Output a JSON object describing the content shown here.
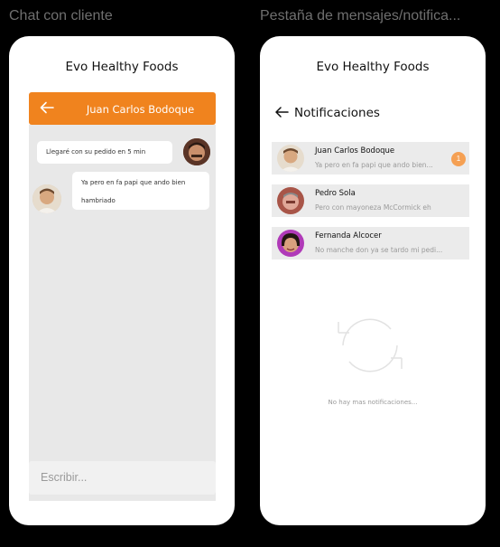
{
  "frames": {
    "chat_label": "Chat con cliente",
    "notifications_label": "Pestaña de mensajes/notifica..."
  },
  "chat": {
    "app_title": "Evo Healthy Foods",
    "header_name": "Juan Carlos Bodoque",
    "messages": [
      {
        "text": "Llegaré con su pedido en 5 min",
        "side": "right"
      },
      {
        "text": "Ya pero en fa papi que ando bien hambriado",
        "side": "left"
      }
    ],
    "compose_placeholder": "Escribir..."
  },
  "notifications": {
    "app_title": "Evo Healthy Foods",
    "heading": "Notificaciones",
    "items": [
      {
        "name": "Juan Carlos Bodoque",
        "message": "Ya pero en fa papi que ando bien...",
        "badge": "1"
      },
      {
        "name": "Pedro Sola",
        "message": "Pero con mayoneza McCormick eh"
      },
      {
        "name": "Fernanda Alcocer",
        "message": "No manche don ya se tardo mi pedi..."
      }
    ],
    "empty_text": "No hay mas notificaciones..."
  },
  "colors": {
    "accent": "#f0831e",
    "badge": "#f5a053",
    "chat_background": "#e8e8e8",
    "item_background": "#ebebeb"
  },
  "icons": [
    "back-arrow-icon",
    "refresh-icon"
  ]
}
